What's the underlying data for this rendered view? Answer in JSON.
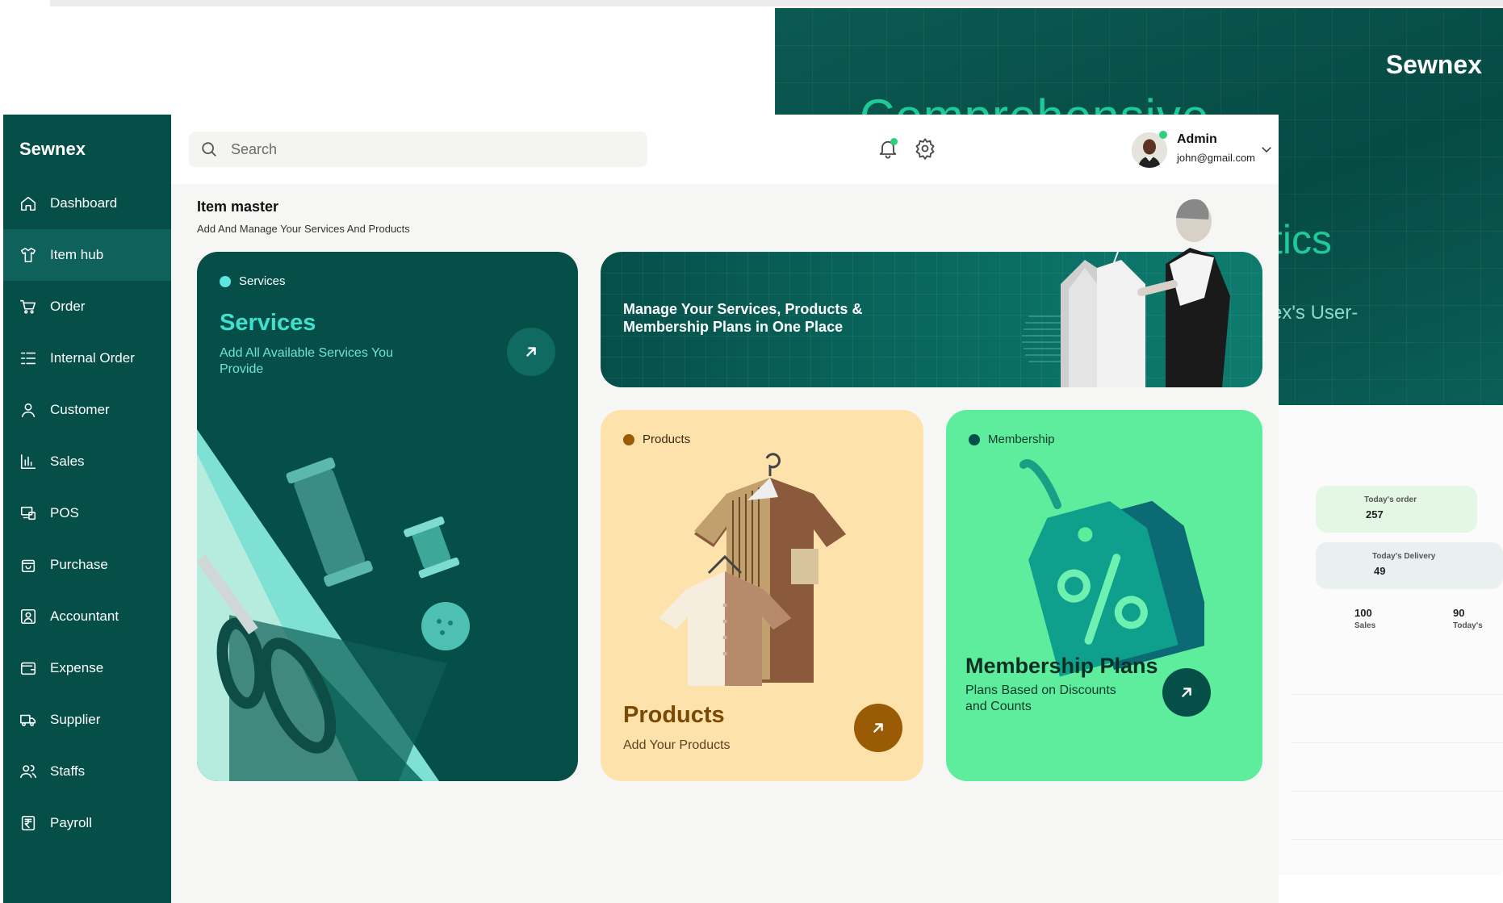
{
  "background": {
    "brand": "Sewnex",
    "title_fragment": "Comprehensive",
    "hero_fragment": "tics",
    "hero_sub_fragment": "ex's User-",
    "stats": [
      {
        "label": "Today's order",
        "value": "257"
      },
      {
        "label": "Today's Delivery",
        "value": "49"
      },
      {
        "label": "Sales",
        "value": "100"
      },
      {
        "label": "Today's",
        "value": "90"
      }
    ]
  },
  "sidebar": {
    "brand": "Sewnex",
    "items": [
      {
        "label": "Dashboard",
        "icon": "home-icon"
      },
      {
        "label": "Item hub",
        "icon": "shirt-icon",
        "active": true
      },
      {
        "label": "Order",
        "icon": "cart-icon"
      },
      {
        "label": "Internal Order",
        "icon": "list-icon"
      },
      {
        "label": "Customer",
        "icon": "user-icon"
      },
      {
        "label": "Sales",
        "icon": "bar-chart-icon"
      },
      {
        "label": "POS",
        "icon": "pos-icon"
      },
      {
        "label": "Purchase",
        "icon": "bag-icon"
      },
      {
        "label": "Accountant",
        "icon": "accountant-icon"
      },
      {
        "label": "Expense",
        "icon": "wallet-icon"
      },
      {
        "label": "Supplier",
        "icon": "truck-icon"
      },
      {
        "label": "Staffs",
        "icon": "users-icon"
      },
      {
        "label": "Payroll",
        "icon": "rupee-icon"
      }
    ]
  },
  "topbar": {
    "search_placeholder": "Search",
    "user": {
      "name": "Admin",
      "email": "john@gmail.com"
    }
  },
  "page": {
    "title": "Item master",
    "subtitle": "Add And Manage Your Services And Products"
  },
  "cards": {
    "services": {
      "tag": "Services",
      "title": "Services",
      "description": "Add All Available Services You Provide",
      "colors": {
        "bg": "#064f49",
        "accent": "#3ee0d0"
      }
    },
    "banner": {
      "text": "Manage Your Services, Products & Membership Plans in One Place"
    },
    "products": {
      "tag": "Products",
      "title": "Products",
      "description": "Add Your Products",
      "colors": {
        "bg": "#fde2ab",
        "accent": "#9a5b06"
      }
    },
    "membership": {
      "tag": "Membership",
      "title": "Membership Plans",
      "description": "Plans Based on Discounts and Counts",
      "colors": {
        "bg": "#5ded9d",
        "accent": "#064f49"
      }
    }
  }
}
